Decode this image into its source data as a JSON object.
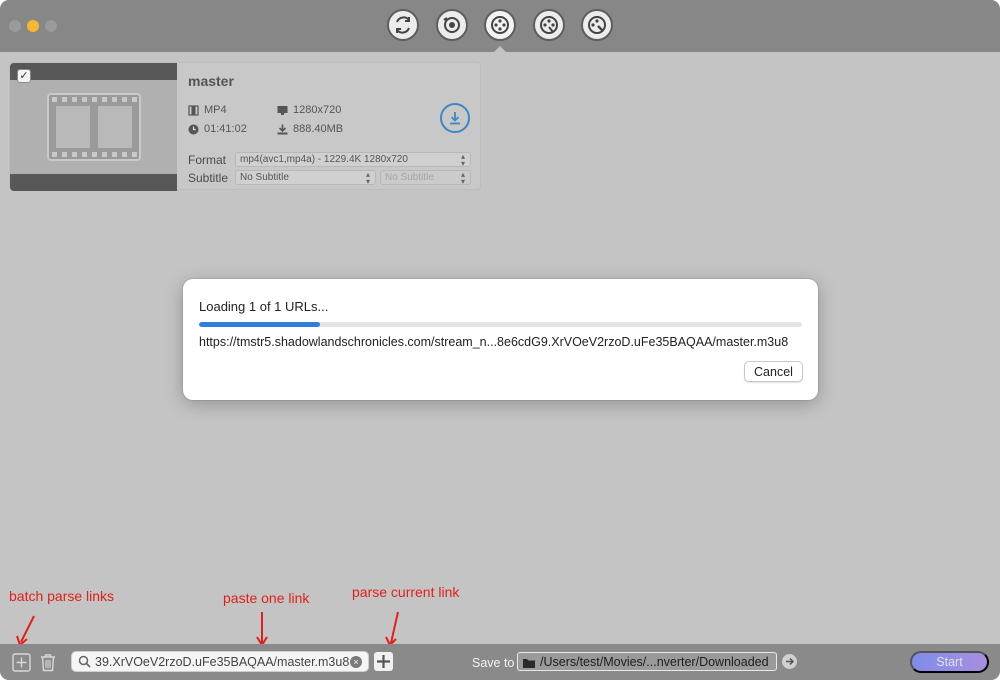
{
  "toolbar": {
    "buttons": [
      {
        "icon": "convert-icon"
      },
      {
        "icon": "record-icon"
      },
      {
        "icon": "download-film-icon"
      },
      {
        "icon": "edit-film-icon"
      },
      {
        "icon": "toolbox-film-icon"
      }
    ],
    "active_index": 2
  },
  "item": {
    "title": "master",
    "checked": "✓",
    "container": "MP4",
    "resolution": "1280x720",
    "duration": "01:41:02",
    "size": "888.40MB",
    "format_label": "Format",
    "format_value": "mp4(avc1,mp4a) - 1229.4K 1280x720",
    "subtitle_label": "Subtitle",
    "subtitle_value": "No Subtitle",
    "subtitle_value2": "No Subtitle"
  },
  "dialog": {
    "status": "Loading 1 of 1 URLs...",
    "progress": 0.2,
    "url": "https://tmstr5.shadowlandschronicles.com/stream_n...8e6cdG9.XrVOeV2rzoD.uFe35BAQAA/master.m3u8",
    "cancel_label": "Cancel"
  },
  "annotations": {
    "batch": "batch parse links",
    "paste": "paste one link",
    "parse": "parse current link"
  },
  "bottom": {
    "link_value": "39.XrVOeV2rzoD.uFe35BAQAA/master.m3u8",
    "clear_glyph": "×",
    "save_to_label": "Save to",
    "save_path": "/Users/test/Movies/...nverter/Downloaded",
    "start_label": "Start"
  },
  "colors": {
    "accent_blue": "#2f7fdc",
    "annotation_red": "#e0211a",
    "minimize_yellow": "#f7b733"
  }
}
